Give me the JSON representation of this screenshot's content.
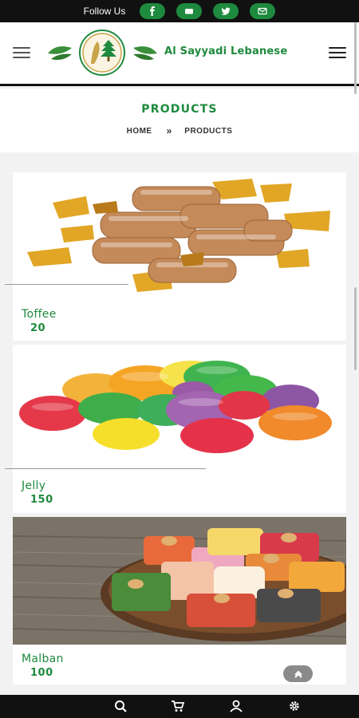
{
  "follow_bar": {
    "label": "Follow Us",
    "icons": [
      "facebook-icon",
      "youtube-icon",
      "twitter-icon",
      "email-icon"
    ]
  },
  "header": {
    "brand": "Al Sayyadi Lebanese",
    "left_icon": "hamburger-menu-icon",
    "right_icon": "hamburger-menu-icon"
  },
  "page": {
    "title": "PRODUCTS",
    "breadcrumb": {
      "home": "HOME",
      "separator": "»",
      "current": "PRODUCTS"
    }
  },
  "products": [
    {
      "name": "Toffee",
      "price": "20"
    },
    {
      "name": "Jelly",
      "price": "150"
    },
    {
      "name": "Malban",
      "price": "100"
    }
  ],
  "bottom_nav": {
    "icons": [
      "search-icon",
      "cart-icon",
      "user-icon",
      "settings-icon"
    ]
  },
  "colors": {
    "brand_green": "#1e8a3e",
    "bar_black": "#111111",
    "back_to_top": "#8a8a8a"
  }
}
